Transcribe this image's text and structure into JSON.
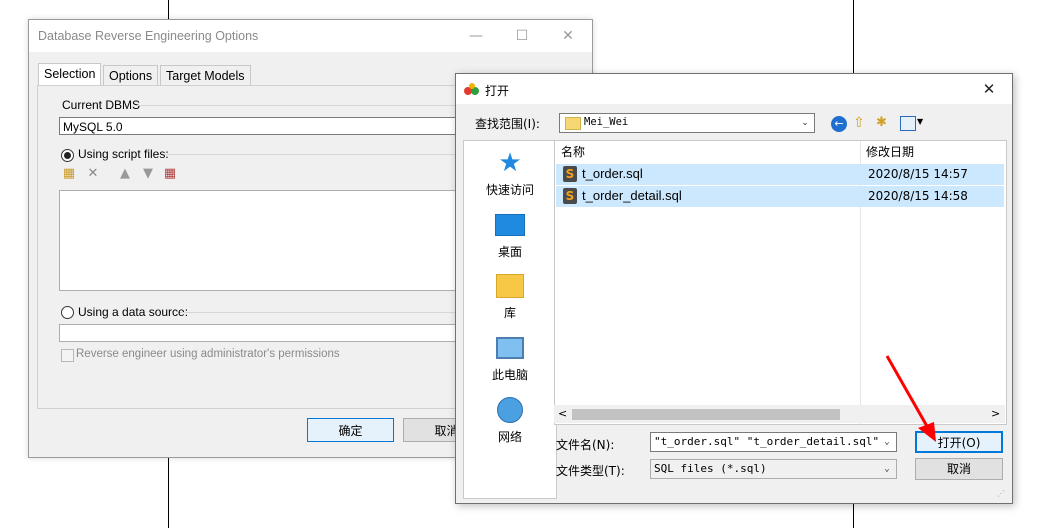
{
  "background_dialog": {
    "title": "Database Reverse Engineering Options",
    "tabs": [
      "Selection",
      "Options",
      "Target Models"
    ],
    "current_dbms_label": "Current DBMS",
    "current_dbms_value": "MySQL 5.0",
    "using_script_files": "Using script files:",
    "using_data_source": "Using a data source:",
    "admin_permissions": "Reverse engineer using administrator's permissions",
    "ok_button": "确定",
    "cancel_button": "取消"
  },
  "open_dialog": {
    "title": "打开",
    "look_in_label": "查找范围(I):",
    "look_in_value": "Mei_Wei",
    "places": [
      "快速访问",
      "桌面",
      "库",
      "此电脑",
      "网络"
    ],
    "columns": {
      "name": "名称",
      "date": "修改日期"
    },
    "files": [
      {
        "name": "t_order.sql",
        "date": "2020/8/15 14:57"
      },
      {
        "name": "t_order_detail.sql",
        "date": "2020/8/15 14:58"
      }
    ],
    "file_name_label": "文件名(N):",
    "file_name_value": "\"t_order.sql\" \"t_order_detail.sql\"",
    "file_type_label": "文件类型(T):",
    "file_type_value": "SQL files (*.sql)",
    "open_button": "打开(O)",
    "cancel_button": "取消"
  },
  "colors": {
    "selection": "#cce8ff",
    "accent": "#0078d7",
    "arrow": "#ff0000"
  }
}
